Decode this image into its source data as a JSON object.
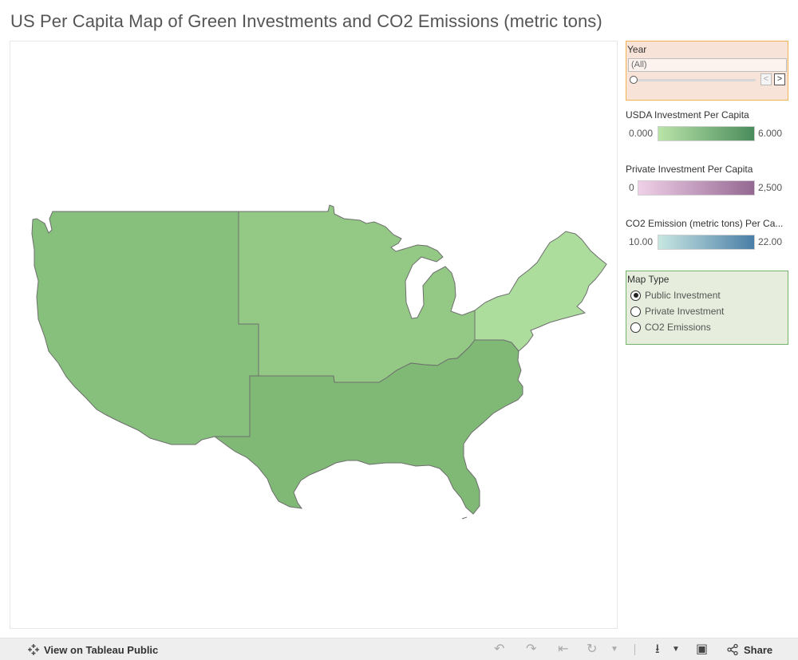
{
  "title": "US Per Capita Map of Green Investments and CO2 Emissions (metric tons)",
  "year_filter": {
    "label": "Year",
    "value": "(All)",
    "prev_glyph": "<",
    "next_glyph": ">"
  },
  "legends": [
    {
      "title": "USDA Investment Per Capita",
      "min": "0.000",
      "max": "6.000",
      "colors": [
        "#b9e4a8",
        "#4a8c5c"
      ]
    },
    {
      "title": "Private Investment Per Capita",
      "min": "0",
      "max": "2,500",
      "colors": [
        "#f0d0e8",
        "#946892"
      ]
    },
    {
      "title": "CO2 Emission (metric tons) Per Ca...",
      "min": "10.00",
      "max": "22.00",
      "colors": [
        "#c8e7e2",
        "#4a7ea6"
      ]
    }
  ],
  "map_type": {
    "label": "Map Type",
    "options": [
      {
        "label": "Public Investment",
        "checked": true
      },
      {
        "label": "Private Investment",
        "checked": false
      },
      {
        "label": "CO2 Emissions",
        "checked": false
      }
    ]
  },
  "map": {
    "regions": [
      {
        "name": "west",
        "color": "#86c07c"
      },
      {
        "name": "midwest",
        "color": "#93c985"
      },
      {
        "name": "south",
        "color": "#80b976"
      },
      {
        "name": "northeast",
        "color": "#acdd9d"
      }
    ]
  },
  "footer": {
    "view_label": "View on Tableau Public",
    "share_label": "Share"
  }
}
